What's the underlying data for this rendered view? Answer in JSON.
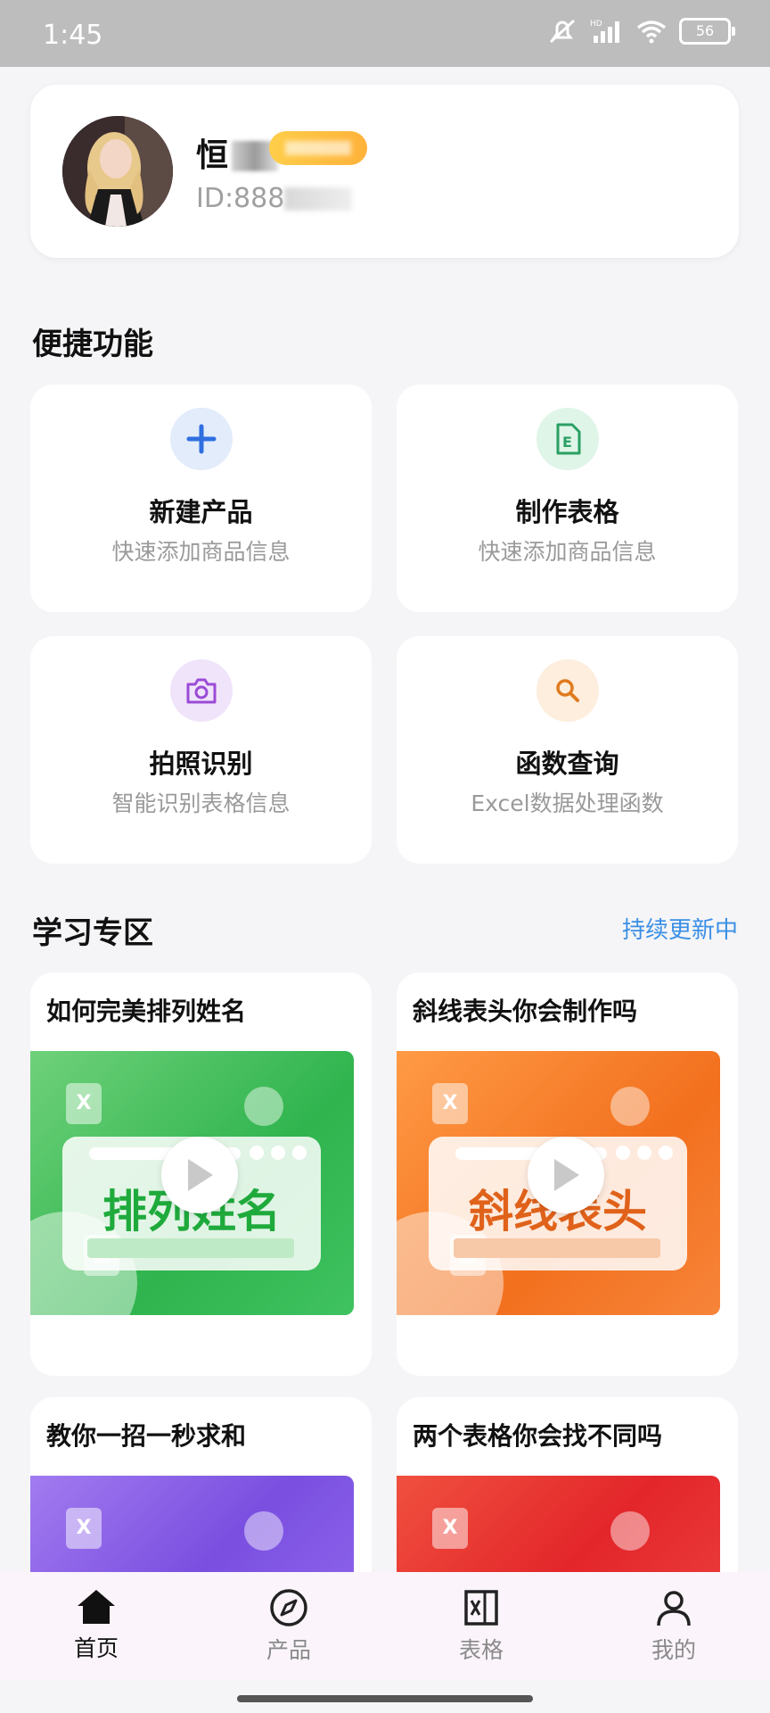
{
  "status_bar": {
    "time": "1:45",
    "battery": "56"
  },
  "profile": {
    "name": "恒",
    "id_label": "ID:888"
  },
  "quick_functions": {
    "title": "便捷功能",
    "items": [
      {
        "title": "新建产品",
        "subtitle": "快速添加商品信息",
        "icon": "plus-icon",
        "color": "#2f6fe0",
        "bg": "#e3ecfb"
      },
      {
        "title": "制作表格",
        "subtitle": "快速添加商品信息",
        "icon": "excel-file-icon",
        "color": "#2aa063",
        "bg": "#dff5e8"
      },
      {
        "title": "拍照识别",
        "subtitle": "智能识别表格信息",
        "icon": "camera-icon",
        "color": "#9b4bd6",
        "bg": "#f0e4fb"
      },
      {
        "title": "函数查询",
        "subtitle": "Excel数据处理函数",
        "icon": "search-icon",
        "color": "#e07a1f",
        "bg": "#fdeedd"
      }
    ]
  },
  "learning": {
    "title": "学习专区",
    "link": "持续更新中",
    "items": [
      {
        "title": "如何完美排列姓名",
        "thumb_text": "排列姓名",
        "theme": "green"
      },
      {
        "title": "斜线表头你会制作吗",
        "thumb_text": "斜线表头",
        "theme": "orange"
      },
      {
        "title": "教你一招一秒求和",
        "thumb_text": "",
        "theme": "purple"
      },
      {
        "title": "两个表格你会找不同吗",
        "thumb_text": "",
        "theme": "red"
      }
    ]
  },
  "bottom_nav": {
    "items": [
      {
        "label": "首页",
        "icon": "home-icon",
        "active": true
      },
      {
        "label": "产品",
        "icon": "compass-icon",
        "active": false
      },
      {
        "label": "表格",
        "icon": "sheet-icon",
        "active": false
      },
      {
        "label": "我的",
        "icon": "person-icon",
        "active": false
      }
    ]
  },
  "colors": {
    "accent_link": "#3a8fe6",
    "vip_gold": "#ffc040"
  }
}
